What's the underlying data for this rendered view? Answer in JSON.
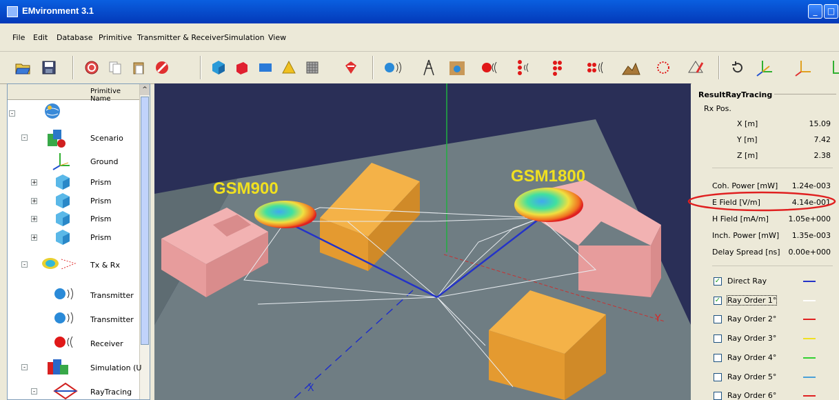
{
  "window": {
    "title": "EMvironment 3.1",
    "minimize_label": "_",
    "maximize_label": "□"
  },
  "menu": [
    "File",
    "Edit",
    "Database",
    "Primitive",
    "Transmitter & Receiver",
    "Simulation",
    "View"
  ],
  "tree": {
    "column_header": "Primitive Name",
    "scroll_up": "^",
    "items": [
      {
        "label": "",
        "expander": "-",
        "icon": "globe-icon"
      },
      {
        "label": "Scenario",
        "expander": "-",
        "icon": "scenario-icon"
      },
      {
        "label": "Ground",
        "expander": "",
        "icon": "axes-icon"
      },
      {
        "label": "Prism",
        "expander": "+",
        "icon": "cube-icon"
      },
      {
        "label": "Prism",
        "expander": "+",
        "icon": "cube-icon"
      },
      {
        "label": "Prism",
        "expander": "+",
        "icon": "cube-icon"
      },
      {
        "label": "Prism",
        "expander": "+",
        "icon": "cube-icon"
      },
      {
        "label": "Tx & Rx",
        "expander": "-",
        "icon": "radiation-pattern-icon"
      },
      {
        "label": "Transmitter",
        "expander": "",
        "icon": "transmitter-icon"
      },
      {
        "label": "Transmitter",
        "expander": "",
        "icon": "transmitter-icon"
      },
      {
        "label": "Receiver",
        "expander": "",
        "icon": "receiver-icon"
      },
      {
        "label": "Simulation  (U",
        "expander": "-",
        "icon": "simulation-icon"
      },
      {
        "label": "RayTracing",
        "expander": "-",
        "icon": "raytracing-icon"
      }
    ]
  },
  "viewport": {
    "labels": {
      "gsm900": "GSM900",
      "gsm1800": "GSM1800",
      "axis_x": "X",
      "axis_y": "Y"
    }
  },
  "result": {
    "title": "ResultRayTracing",
    "rx_pos_label": "Rx Pos.",
    "x_label": "X [m]",
    "x_value": "15.09",
    "y_label": "Y [m]",
    "y_value": "7.42",
    "z_label": "Z [m]",
    "z_value": "2.38",
    "coh_power_label": "Coh. Power [mW]",
    "coh_power_value": "1.24e-003",
    "efield_label": "E Field [V/m]",
    "efield_value": "4.14e-001",
    "hfield_label": "H Field [mA/m]",
    "hfield_value": "1.05e+000",
    "inch_power_label": "Inch. Power [mW]",
    "inch_power_value": "1.35e-003",
    "delay_label": "Delay Spread [ns]",
    "delay_value": "0.00e+000"
  },
  "rays": [
    {
      "label": "Direct Ray",
      "checked": true,
      "color": "#2433c8"
    },
    {
      "label": "Ray Order 1°",
      "checked": true,
      "color": "#ffffff"
    },
    {
      "label": "Ray Order 2°",
      "checked": false,
      "color": "#e02020"
    },
    {
      "label": "Ray Order 3°",
      "checked": false,
      "color": "#f0e020"
    },
    {
      "label": "Ray Order 4°",
      "checked": false,
      "color": "#30d030"
    },
    {
      "label": "Ray Order 5°",
      "checked": false,
      "color": "#4aa0d8"
    },
    {
      "label": "Ray Order 6°",
      "checked": false,
      "color": "#e02020"
    }
  ],
  "colors": {
    "building_orange": "#f0a030",
    "building_pink": "#f0a8a8",
    "ground": "#6e7c82",
    "highlight": "#e02020"
  }
}
